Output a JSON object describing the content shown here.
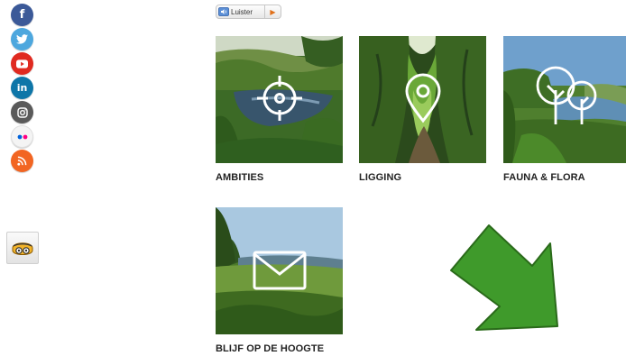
{
  "social": [
    {
      "network": "facebook",
      "icon": "facebook-icon",
      "glyph": "f",
      "color": "#3b5998"
    },
    {
      "network": "twitter",
      "icon": "twitter-icon",
      "glyph": "🐦",
      "color": "#4da7de"
    },
    {
      "network": "youtube",
      "icon": "youtube-icon",
      "glyph": "▶",
      "color": "#e02a20"
    },
    {
      "network": "linkedin",
      "icon": "linkedin-icon",
      "glyph": "in",
      "color": "#0e76a8"
    },
    {
      "network": "instagram",
      "icon": "instagram-icon",
      "glyph": "◎",
      "color": "#5a5a5a"
    },
    {
      "network": "flickr",
      "icon": "flickr-icon",
      "glyph": "••",
      "color": "#f2f2f2"
    },
    {
      "network": "rss",
      "icon": "rss-icon",
      "glyph": ")",
      "color": "#f26522"
    }
  ],
  "listen": {
    "label": "Luister",
    "accent": "#e0701a"
  },
  "tiles": [
    {
      "label": "AMBITIES",
      "icon": "target-icon"
    },
    {
      "label": "LIGGING",
      "icon": "location-pin-icon"
    },
    {
      "label": "FAUNA & FLORA",
      "icon": "trees-icon"
    },
    {
      "label": "BLIJF OP DE HOOGTE",
      "icon": "envelope-icon"
    }
  ],
  "annotation": {
    "color": "#3f9a2b",
    "icon": "arrow-down-right-icon"
  }
}
